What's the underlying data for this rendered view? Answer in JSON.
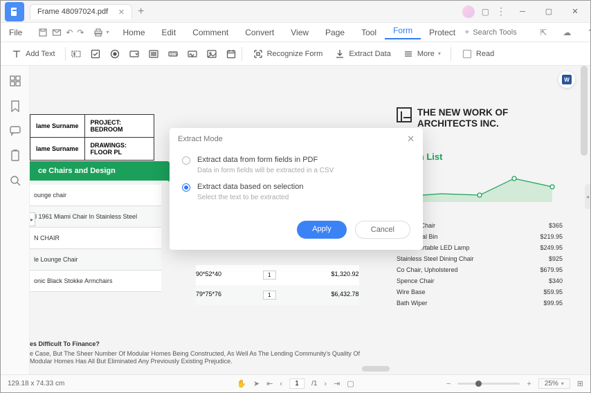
{
  "titlebar": {
    "tab_name": "Frame 48097024.pdf"
  },
  "menubar": {
    "file": "File",
    "items": [
      "Home",
      "Edit",
      "Comment",
      "Convert",
      "View",
      "Page",
      "Tool",
      "Form",
      "Protect"
    ],
    "active_index": 7,
    "search_placeholder": "Search Tools"
  },
  "toolbar": {
    "add_text": "Add Text",
    "recognize": "Recognize Form",
    "extract": "Extract Data",
    "more": "More",
    "read": "Read"
  },
  "doc": {
    "left_table": {
      "r1c1": "lame Surname",
      "r1c2": "PROJECT: BEDROOM",
      "r2c1": "lame Surname",
      "r2c2": "DRAWINGS: FLOOR PL"
    },
    "green_banner": "ce Chairs and Design",
    "left_items": [
      "ounge chair",
      "il 1961 Miami Chair In Stainless Steel",
      "N CHAIR",
      "le Lounge Chair",
      "onic Black Stokke Armchairs"
    ],
    "mid_rows": [
      {
        "dim": "90*52*40",
        "qty": "1",
        "price": "$1,320.92"
      },
      {
        "dim": "79*75*76",
        "qty": "1",
        "price": "$6,432.78"
      }
    ],
    "right": {
      "title_l1": "THE NEW WORK OF",
      "title_l2": "ARCHITECTS INC.",
      "subtitle": "nption List",
      "prices": [
        {
          "n": "Herman Chair",
          "p": "$365"
        },
        {
          "n": "Bath Pedal Bin",
          "p": "$219.95"
        },
        {
          "n": "Carrie Portable LED Lamp",
          "p": "$249.95"
        },
        {
          "n": "Stainless Steel Dining Chair",
          "p": "$925"
        },
        {
          "n": "Co Chair, Upholstered",
          "p": "$679.95"
        },
        {
          "n": "Spence Chair",
          "p": "$340"
        },
        {
          "n": "Wire Base",
          "p": "$59.95"
        },
        {
          "n": "Bath Wiper",
          "p": "$99.95"
        }
      ]
    },
    "bottom": {
      "title": "es Difficult To Finance?",
      "body": "e Case, But The Sheer Number Of Modular Homes Being Constructed, As Well As The Lending Community's Quality Of Modular Homes Has All But Eliminated Any Previously Existing Prejudice."
    }
  },
  "modal": {
    "title": "Extract Mode",
    "opt1": {
      "label": "Extract data from form fields in PDF",
      "sub": "Data in form fields will be extracted in a CSV"
    },
    "opt2": {
      "label": "Extract data based on selection",
      "sub": "Select the text to be extracted"
    },
    "apply": "Apply",
    "cancel": "Cancel"
  },
  "statusbar": {
    "dims": "129.18 x 74.33 cm",
    "page_current": "1",
    "page_sep": "/1",
    "zoom": "25%"
  }
}
